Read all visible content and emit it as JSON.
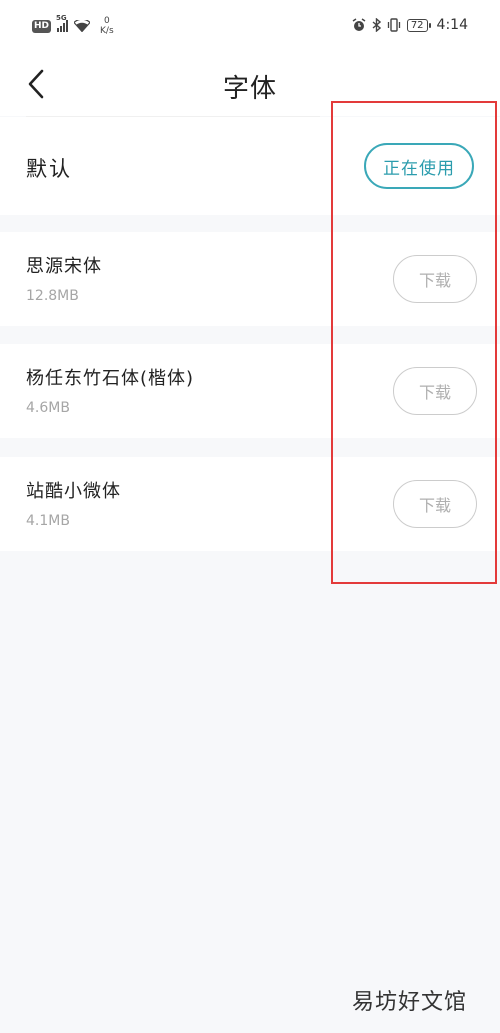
{
  "status_bar": {
    "hd": "HD",
    "network_type": "5G",
    "speed_value": "0",
    "speed_unit": "K/s",
    "battery": "72",
    "time": "4:14"
  },
  "nav": {
    "title": "字体"
  },
  "default_font": {
    "label": "默认",
    "button_label": "正在使用"
  },
  "fonts": [
    {
      "name": "思源宋体",
      "size": "12.8MB",
      "button_label": "下载"
    },
    {
      "name": "杨任东竹石体(楷体)",
      "size": "4.6MB",
      "button_label": "下载"
    },
    {
      "name": "站酷小微体",
      "size": "4.1MB",
      "button_label": "下载"
    }
  ],
  "watermark": "易坊好文馆",
  "colors": {
    "accent": "#2b9cad",
    "highlight": "#e33a3a",
    "background": "#f7f8fa"
  }
}
